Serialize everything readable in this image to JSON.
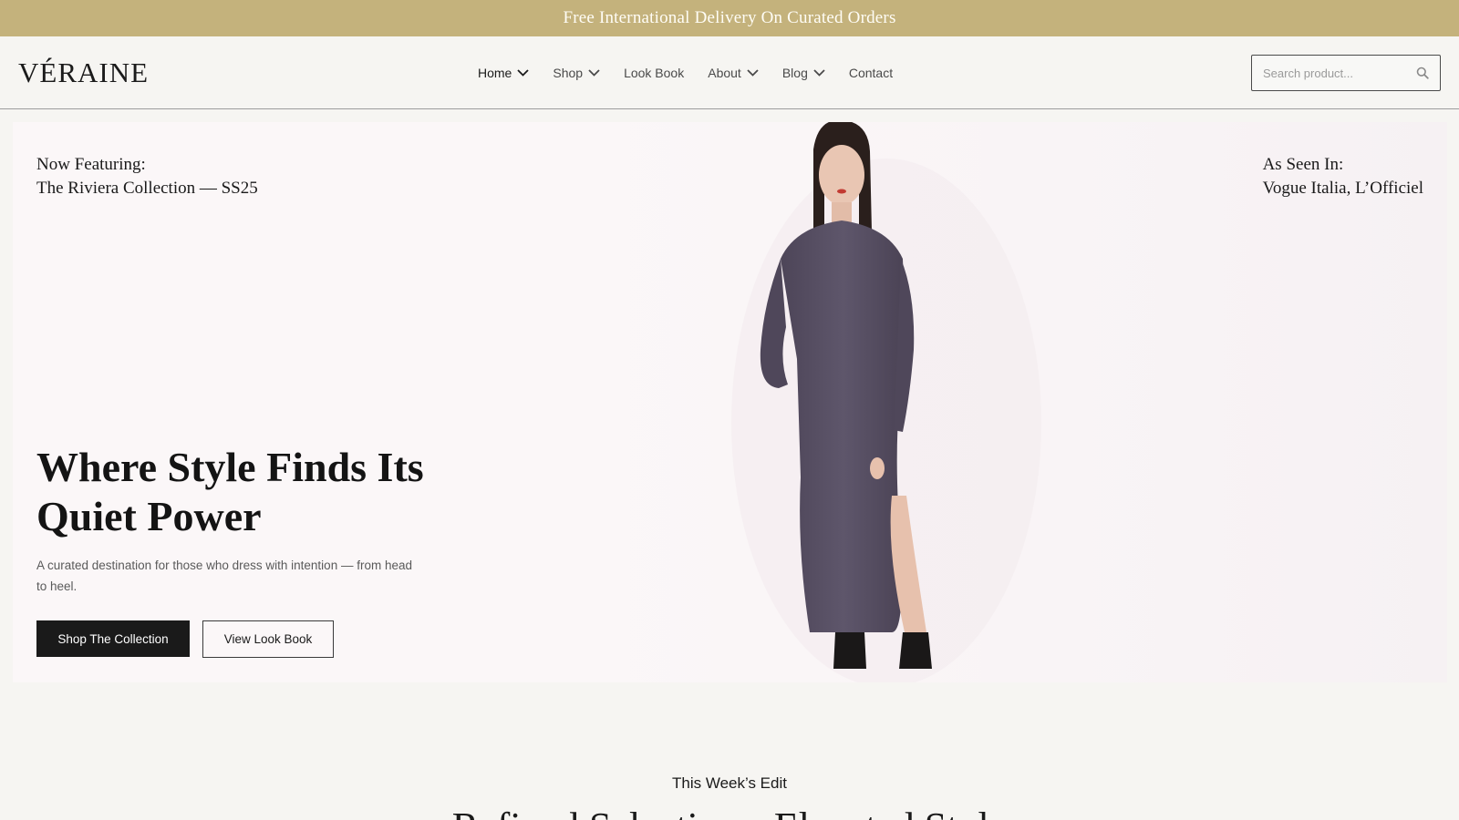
{
  "announcement": "Free International Delivery On Curated Orders",
  "header": {
    "logo": "VÉRAINE",
    "nav": [
      {
        "label": "Home",
        "has_dropdown": true,
        "active": true
      },
      {
        "label": "Shop",
        "has_dropdown": true
      },
      {
        "label": "Look Book",
        "has_dropdown": false
      },
      {
        "label": "About",
        "has_dropdown": true
      },
      {
        "label": "Blog",
        "has_dropdown": true
      },
      {
        "label": "Contact",
        "has_dropdown": false
      }
    ],
    "search_placeholder": "Search product..."
  },
  "hero": {
    "featuring_line1": "Now Featuring:",
    "featuring_line2": "The Riviera Collection — SS25",
    "seen_line1": "As Seen In:",
    "seen_line2": "Vogue Italia, L’Officiel",
    "title": "Where Style Finds Its Quiet Power",
    "subtitle": "A curated destination for those who dress with intention — from head to heel.",
    "primary_button": "Shop The Collection",
    "secondary_button": "View Look Book"
  },
  "section": {
    "kicker": "This Week’s Edit",
    "title": "Refined Selections, Elevated Style"
  },
  "colors": {
    "announcement_bg": "#c4b27c",
    "dress": "#5a5166",
    "primary_button_bg": "#1a1a1a"
  }
}
